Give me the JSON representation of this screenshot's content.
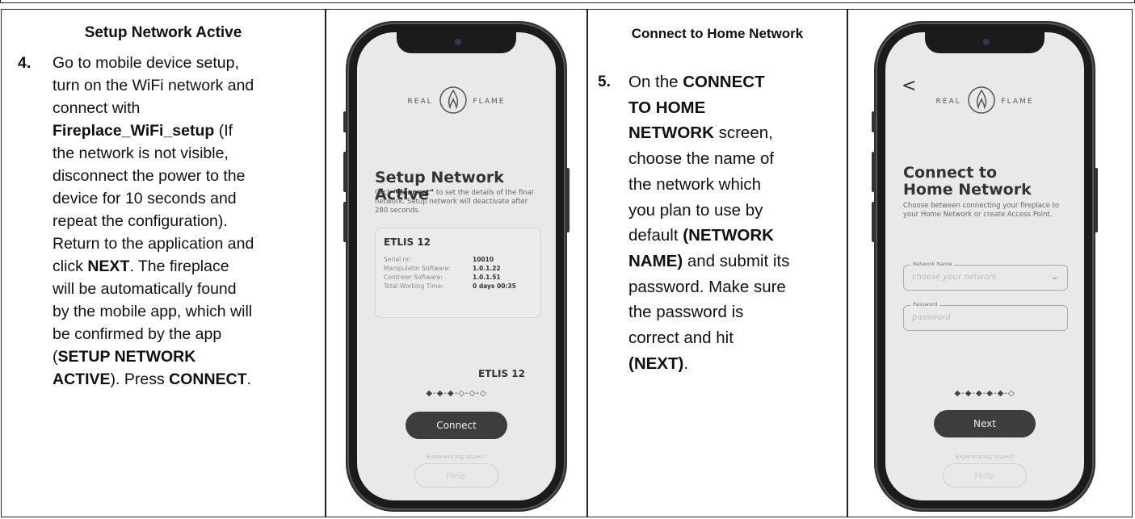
{
  "step4": {
    "header": "Setup Network Active",
    "number": "4.",
    "lines": [
      [
        {
          "t": "Go to mobile device setup,"
        }
      ],
      [
        {
          "t": "turn on the WiFi network and"
        }
      ],
      [
        {
          "t": "connect with"
        }
      ],
      [
        {
          "t": "Fireplace_WiFi_setup",
          "b": true
        },
        {
          "t": " (If"
        }
      ],
      [
        {
          "t": "the network is not visible,"
        }
      ],
      [
        {
          "t": "disconnect the power to the"
        }
      ],
      [
        {
          "t": "device for 10 seconds and"
        }
      ],
      [
        {
          "t": "repeat the configuration)."
        }
      ],
      [
        {
          "t": "Return to the application and"
        }
      ],
      [
        {
          "t": "click "
        },
        {
          "t": "NEXT",
          "b": true
        },
        {
          "t": ". The fireplace"
        }
      ],
      [
        {
          "t": "will be automatically found"
        }
      ],
      [
        {
          "t": "by the mobile app, which will"
        }
      ],
      [
        {
          "t": "be confirmed by the app"
        }
      ],
      [
        {
          "t": "("
        },
        {
          "t": "SETUP NETWORK",
          "b": true
        }
      ],
      [
        {
          "t": "ACTIVE",
          "b": true
        },
        {
          "t": "). Press "
        },
        {
          "t": "CONNECT",
          "b": true
        },
        {
          "t": "."
        }
      ]
    ]
  },
  "step5": {
    "header": "Connect to Home Network",
    "number": "5.",
    "lines": [
      [
        {
          "t": "On the "
        },
        {
          "t": "CONNECT",
          "b": true
        }
      ],
      [
        {
          "t": "TO HOME",
          "b": true
        }
      ],
      [
        {
          "t": "NETWORK",
          "b": true
        },
        {
          "t": " screen,"
        }
      ],
      [
        {
          "t": "choose the name of"
        }
      ],
      [
        {
          "t": "the network which"
        }
      ],
      [
        {
          "t": "you plan to use by"
        }
      ],
      [
        {
          "t": "default "
        },
        {
          "t": "(NETWORK",
          "b": true
        }
      ],
      [
        {
          "t": "NAME)",
          "b": true
        },
        {
          "t": " and submit its"
        }
      ],
      [
        {
          "t": "password. Make sure"
        }
      ],
      [
        {
          "t": "the password is"
        }
      ],
      [
        {
          "t": "correct and hit"
        }
      ],
      [
        {
          "t": "(NEXT)",
          "b": true
        },
        {
          "t": "."
        }
      ]
    ]
  },
  "phone1": {
    "logo_left": "REAL",
    "logo_right": "FLAME",
    "title": "Setup Network Active",
    "desc_pre": "Click ",
    "desc_bold": "“Connect”",
    "desc_post": " to set the details of the final network. Setup network will deactivate after 280 seconds.",
    "card_title": "ETLIS 12",
    "rows": [
      {
        "k": "Serial nr:",
        "v": "10010"
      },
      {
        "k": "Manipulator Software:",
        "v": "1.0.1.22"
      },
      {
        "k": "Controler Software:",
        "v": "1.0.1.51"
      },
      {
        "k": "Total Working Time:",
        "v": "0 days  00:35"
      }
    ],
    "device_name": "ETLIS 12",
    "progress": "◆-◆-◆-◇-◇-◇",
    "button": "Connect",
    "issues": "Experiencing issues?",
    "help": "Help"
  },
  "phone2": {
    "back": "<",
    "logo_left": "REAL",
    "logo_right": "FLAME",
    "title_line1": "Connect to",
    "title_line2": "Home Network",
    "desc": "Choose between connecting your fireplace to your Home Network or create Access Point.",
    "network_label": "Network Name",
    "network_placeholder": "choose your network",
    "password_label": "Password",
    "password_placeholder": "password",
    "progress": "◆-◆-◆-◆-◆-◇",
    "button": "Next",
    "issues": "Experiencing issues?",
    "help": "Help"
  }
}
